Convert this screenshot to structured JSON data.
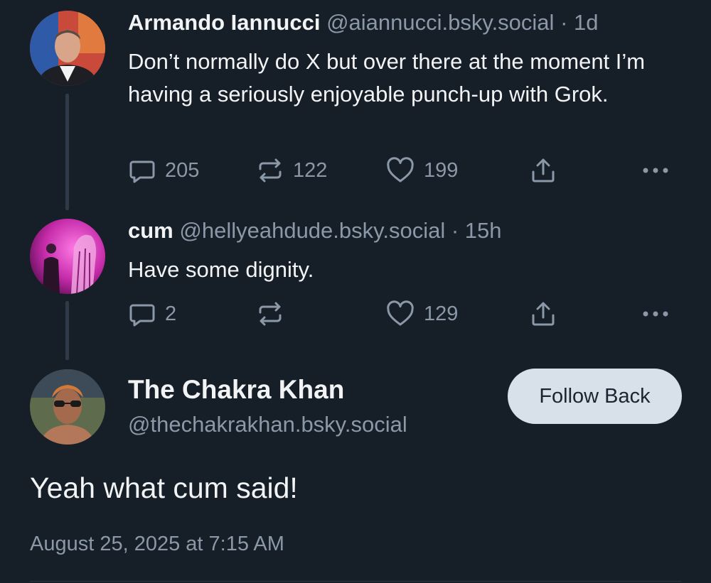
{
  "colors": {
    "background": "#161e27",
    "text_primary": "#f1f3f5",
    "text_secondary": "#8b98a8",
    "thread_line": "#2e3a48",
    "follow_button_bg": "#d8e1ea"
  },
  "posts": [
    {
      "author": "Armando Iannucci",
      "handle": "@aiannucci.bsky.social",
      "separator": "·",
      "time": "1d",
      "text": "Don’t normally do X but over there at the moment I’m having a seriously enjoyable punch-up with Grok.",
      "replies": "205",
      "reposts": "122",
      "likes": "199",
      "icons": [
        "reply-icon",
        "repost-icon",
        "like-icon",
        "share-icon",
        "more-icon"
      ]
    },
    {
      "author": "cum",
      "handle": "@hellyeahdude.bsky.social",
      "separator": "·",
      "time": "15h",
      "text": "Have some dignity.",
      "replies": "2",
      "reposts": "",
      "likes": "129",
      "icons": [
        "reply-icon",
        "repost-icon",
        "like-icon",
        "share-icon",
        "more-icon"
      ]
    }
  ],
  "focused_post": {
    "author": "The Chakra Khan",
    "handle": "@thechakrakhan.bsky.social",
    "follow_label": "Follow Back",
    "text": "Yeah what cum said!",
    "timestamp": "August 25, 2025 at 7:15 AM"
  }
}
